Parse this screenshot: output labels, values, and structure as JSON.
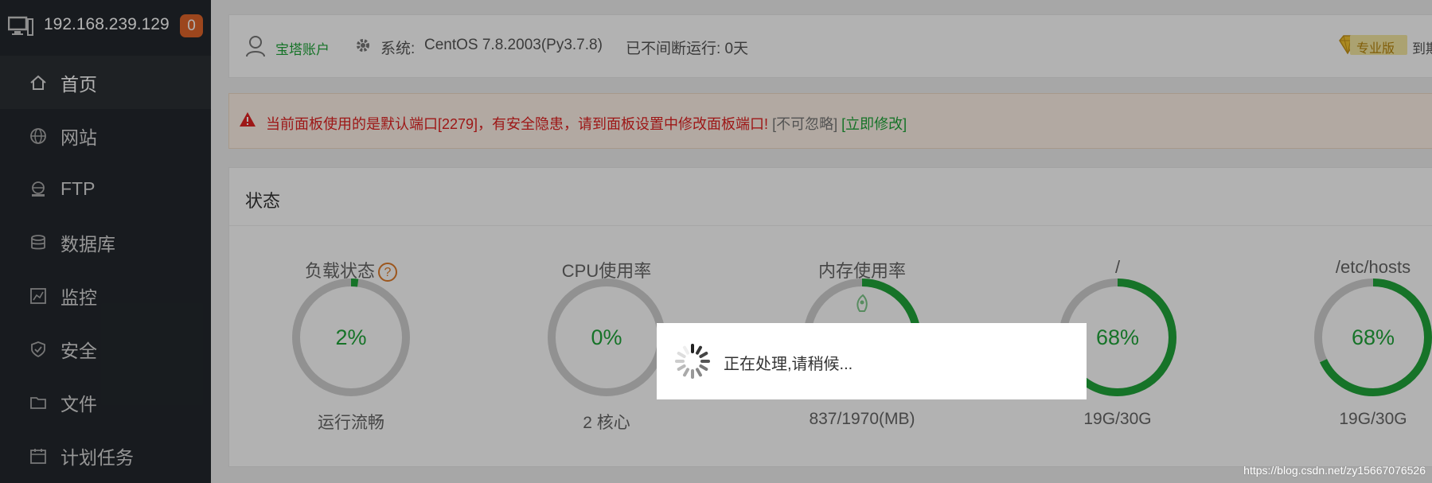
{
  "sidebar": {
    "host_ip": "192.168.239.129",
    "badge_count": "0",
    "items": [
      {
        "label": "首页",
        "icon": "home-icon",
        "active": true
      },
      {
        "label": "网站",
        "icon": "globe-icon"
      },
      {
        "label": "FTP",
        "icon": "ftp-icon"
      },
      {
        "label": "数据库",
        "icon": "database-icon"
      },
      {
        "label": "监控",
        "icon": "monitor-icon"
      },
      {
        "label": "安全",
        "icon": "shield-icon"
      },
      {
        "label": "文件",
        "icon": "folder-icon"
      },
      {
        "label": "计划任务",
        "icon": "calendar-icon"
      }
    ]
  },
  "topbar": {
    "account": "宝塔账户",
    "system_label": "系统:",
    "system_value": "CentOS 7.8.2003(Py3.7.8)",
    "uptime": "已不间断运行: 0天",
    "pro_label": "专业版",
    "expire_label": "到期时"
  },
  "alert": {
    "message": "当前面板使用的是默认端口[2279]，有安全隐患，请到面板设置中修改面板端口!",
    "ignore": "[不可忽略]",
    "fix": "[立即修改]"
  },
  "status": {
    "title": "状态",
    "gauges": [
      {
        "title": "负载状态",
        "value": "2%",
        "sub": "运行流畅",
        "percent": 2
      },
      {
        "title": "CPU使用率",
        "value": "0%",
        "sub": "2 核心",
        "percent": 0
      },
      {
        "title": "内存使用率",
        "value": "",
        "sub": "837/1970(MB)",
        "percent": 42
      },
      {
        "title": "/",
        "value": "68%",
        "sub": "19G/30G",
        "percent": 68
      },
      {
        "title": "/etc/hosts",
        "value": "68%",
        "sub": "19G/30G",
        "percent": 68
      }
    ]
  },
  "loading": {
    "text": "正在处理,请稍候..."
  },
  "watermark": "https://blog.csdn.net/zy15667076526",
  "colors": {
    "sidebar_bg": "#23282d",
    "accent_green": "#20a53a",
    "badge_orange": "#e0652a",
    "alert_red": "#e12121"
  }
}
